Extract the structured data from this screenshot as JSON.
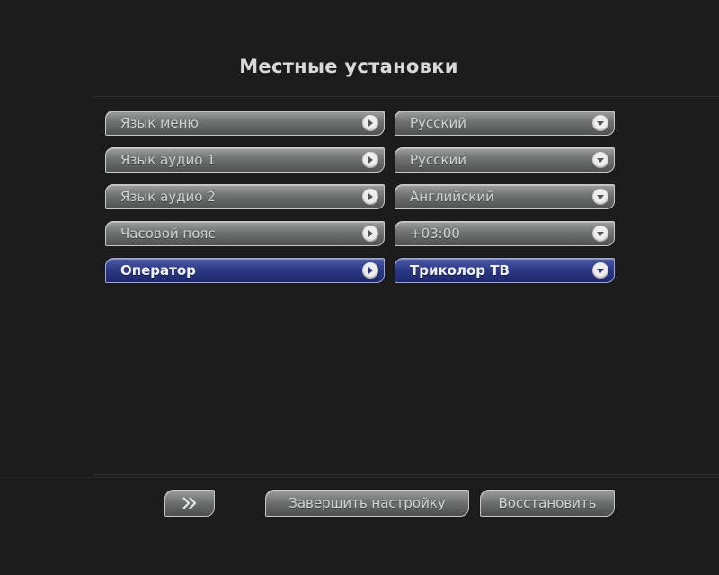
{
  "title": "Местные установки",
  "rows": [
    {
      "label": "Язык меню",
      "value": "Русский"
    },
    {
      "label": "Язык аудио 1",
      "value": "Русский"
    },
    {
      "label": "Язык аудио 2",
      "value": "Английский"
    },
    {
      "label": "Часовой пояс",
      "value": "+03:00"
    },
    {
      "label": "Оператор",
      "value": "Триколор ТВ"
    }
  ],
  "selected_row": "Оператор",
  "buttons": {
    "finish": "Завершить настройку",
    "restore": "Восстановить"
  },
  "icons": {
    "row_arrow": "arrow-right-icon",
    "value_dropdown": "chevron-down-icon",
    "next": "double-chevron-right-icon"
  },
  "colors": {
    "background": "#1d1c1c",
    "item": "#6f7271",
    "item_active": "#2b3884"
  }
}
